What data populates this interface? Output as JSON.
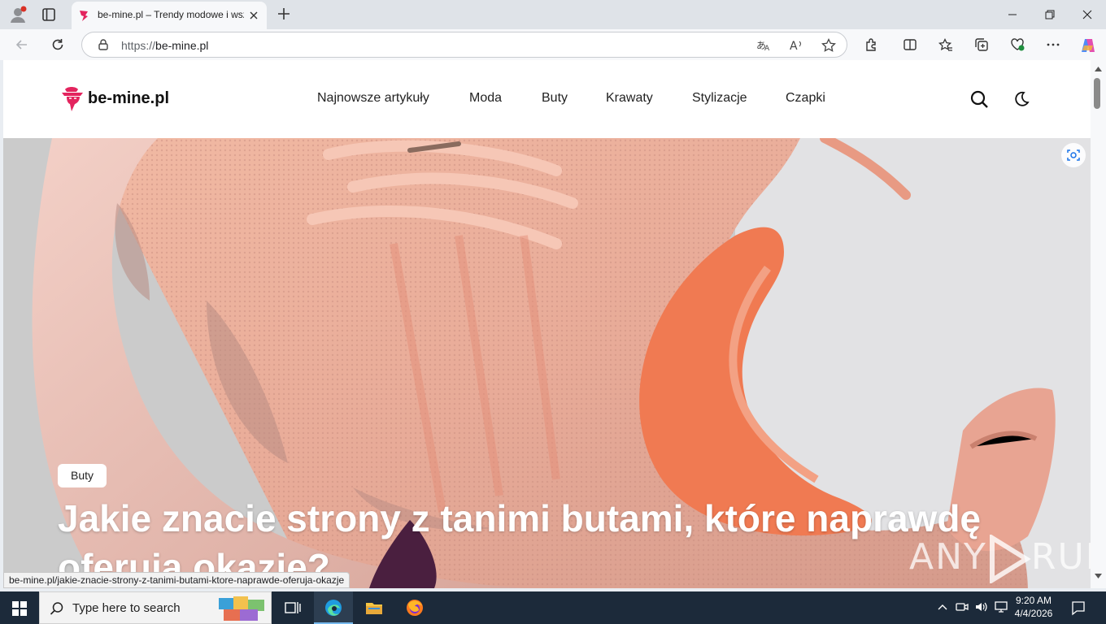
{
  "browser": {
    "tab_title": "be-mine.pl – Trendy modowe i wszystko o modzie",
    "url_scheme": "https://",
    "url_host": "be-mine.pl",
    "status_url": "be-mine.pl/jakie-znacie-strony-z-tanimi-butami-ktore-naprawde-oferuja-okazje"
  },
  "site": {
    "logo_text": "be-mine.pl",
    "brand_color": "#e3245e",
    "nav": [
      "Najnowsze artykuły",
      "Moda",
      "Buty",
      "Krawaty",
      "Stylizacje",
      "Czapki"
    ]
  },
  "hero": {
    "category": "Buty",
    "title": "Jakie znacie strony z tanimi butami, które naprawdę oferują okazje?"
  },
  "watermark": {
    "left": "ANY",
    "right": "RUN"
  },
  "taskbar": {
    "search_placeholder": "Type here to search",
    "time": "9:20 AM",
    "date": "4/4/2026",
    "apps": [
      "task-view",
      "edge",
      "file-explorer",
      "firefox"
    ]
  }
}
